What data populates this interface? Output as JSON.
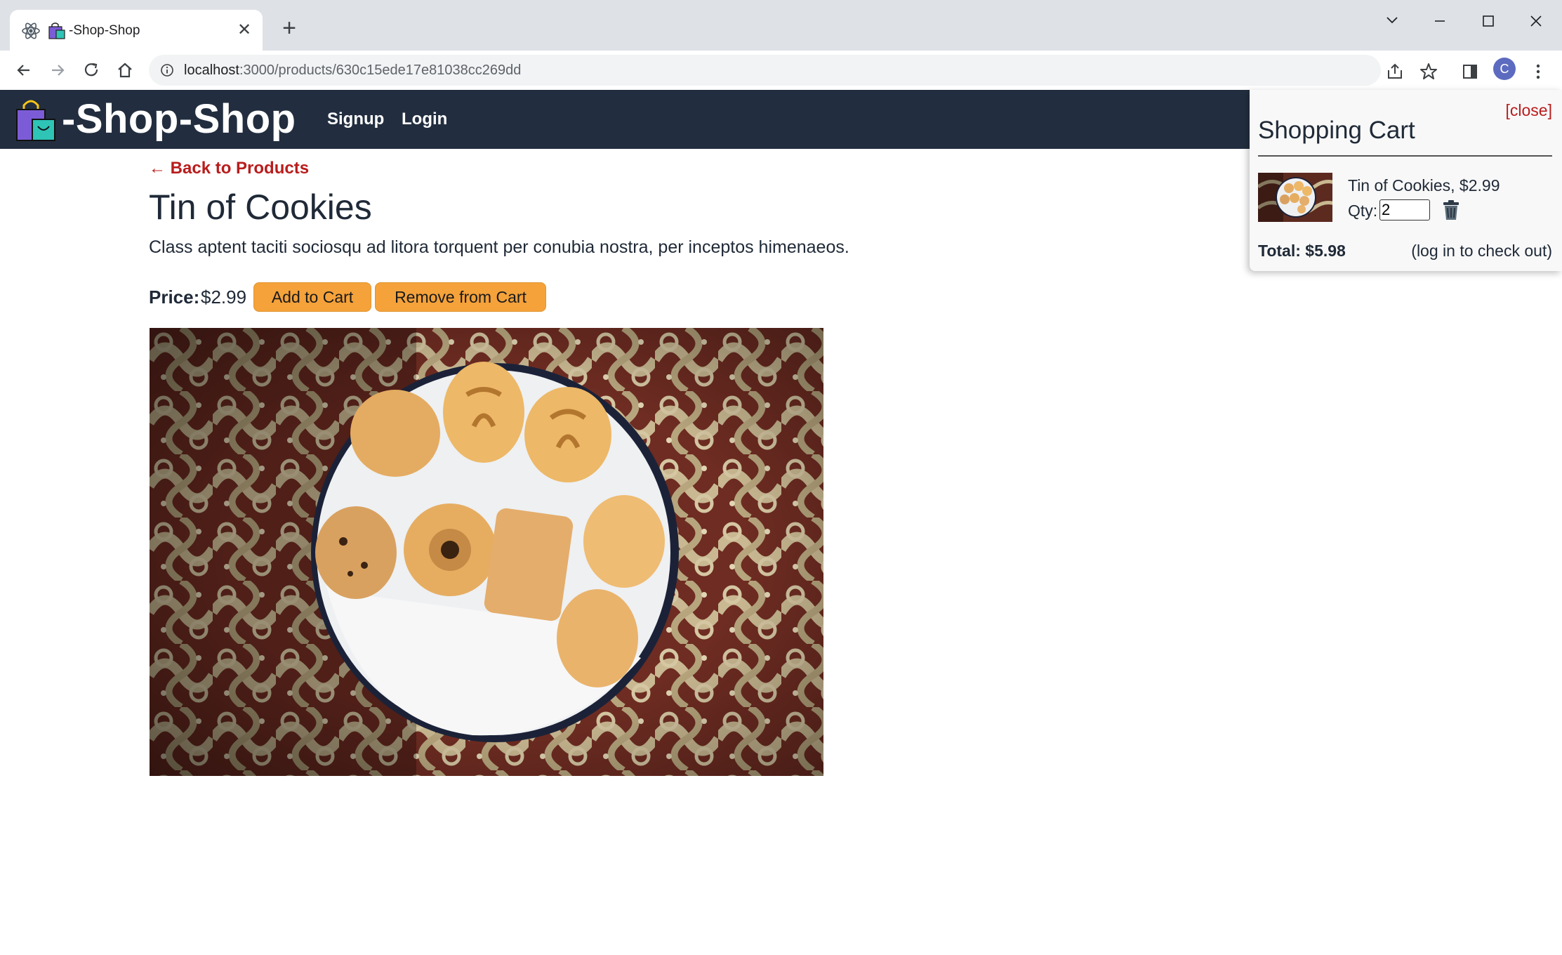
{
  "browser": {
    "tab_title": "-Shop-Shop",
    "tab_close": "✕",
    "new_tab": "+",
    "url_host": "localhost",
    "url_rest": ":3000/products/630c15ede17e81038cc269dd",
    "profile_initial": "C"
  },
  "header": {
    "title": "-Shop-Shop",
    "nav": {
      "signup": "Signup",
      "login": "Login"
    }
  },
  "product": {
    "back_link": "← Back to Products",
    "name": "Tin of Cookies",
    "description": "Class aptent taciti sociosqu ad litora torquent per conubia nostra, per inceptos himenaeos.",
    "price_label": "Price:",
    "price": "$2.99",
    "add_button": "Add to Cart",
    "remove_button": "Remove from Cart"
  },
  "cart": {
    "close": "[close]",
    "title": "Shopping Cart",
    "items": [
      {
        "line": "Tin of Cookies, $2.99",
        "qty_label": "Qty:",
        "qty": "2"
      }
    ],
    "total": "Total: $5.98",
    "checkout_note": "(log in to check out)"
  },
  "colors": {
    "header_bg": "#222e3f",
    "button_bg": "#f5a23b",
    "link": "#b91c1c",
    "cart_bg": "#f8f8f8"
  },
  "icons": [
    "react-icon",
    "shop-bag-icon",
    "back-icon",
    "forward-icon",
    "reload-icon",
    "home-icon",
    "info-icon",
    "share-icon",
    "star-icon",
    "side-panel-icon",
    "menu-icon",
    "trash-icon"
  ]
}
